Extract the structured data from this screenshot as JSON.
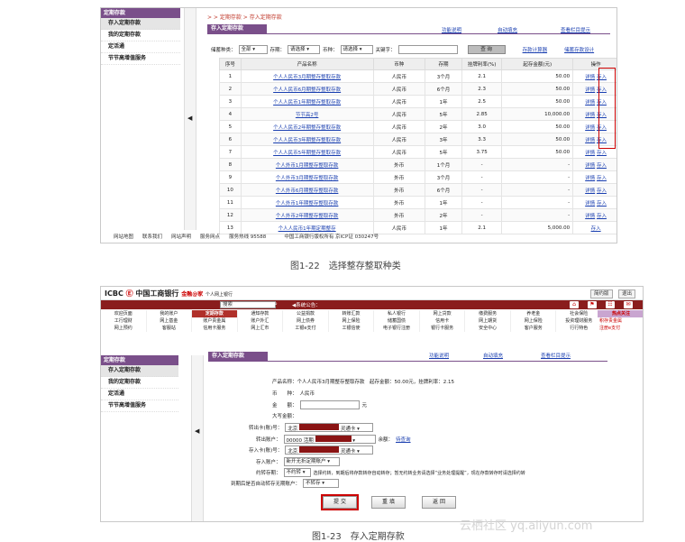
{
  "fig1": {
    "sidebar": {
      "header": "定期存款",
      "items": [
        "存入定期存款",
        "我的定期存款",
        "定活通",
        "节节高增值服务"
      ]
    },
    "breadcrumb": "> > 定期存款 > 存入定期存款",
    "panel_title": "存入定期存款",
    "top_links": [
      "功能说明",
      "自动填充",
      "查看栏目提示"
    ],
    "filters": {
      "store_type_label": "储蓄种类：",
      "store_type_value": "全部",
      "term_label": "存期：",
      "term_value": "请选择",
      "currency_label": "币种：",
      "currency_value": "请选择",
      "keyword_label": "关键字：",
      "query_button": "查 询",
      "calc_link": "存款计算器",
      "design_link": "储蓄存款设计"
    },
    "table": {
      "headers": [
        "序号",
        "产品名称",
        "币种",
        "存期",
        "挂牌利率(%)",
        "起存金额(元)",
        "操作"
      ],
      "rows": [
        {
          "no": "1",
          "name": "个人人民币3月期整存整取存款",
          "cur": "人民币",
          "term": "3个月",
          "rate": "2.1",
          "min": "50.00",
          "detail": "详情",
          "action": "存入"
        },
        {
          "no": "2",
          "name": "个人人民币6月期整存整取存款",
          "cur": "人民币",
          "term": "6个月",
          "rate": "2.3",
          "min": "50.00",
          "detail": "详情",
          "action": "存入"
        },
        {
          "no": "3",
          "name": "个人人民币1年期整存整取存款",
          "cur": "人民币",
          "term": "1年",
          "rate": "2.5",
          "min": "50.00",
          "detail": "详情",
          "action": "存入"
        },
        {
          "no": "4",
          "name": "节节高2号",
          "cur": "人民币",
          "term": "5年",
          "rate": "2.85",
          "min": "10,000.00",
          "detail": "详情",
          "action": "存入"
        },
        {
          "no": "5",
          "name": "个人人民币2年期整存整取存款",
          "cur": "人民币",
          "term": "2年",
          "rate": "3.0",
          "min": "50.00",
          "detail": "详情",
          "action": "存入"
        },
        {
          "no": "6",
          "name": "个人人民币3年期整存整取存款",
          "cur": "人民币",
          "term": "3年",
          "rate": "3.3",
          "min": "50.00",
          "detail": "详情",
          "action": "存入"
        },
        {
          "no": "7",
          "name": "个人人民币5年期整存整取存款",
          "cur": "人民币",
          "term": "5年",
          "rate": "3.75",
          "min": "50.00",
          "detail": "详情",
          "action": "存入"
        },
        {
          "no": "8",
          "name": "个人外币1月期整存整取存款",
          "cur": "外币",
          "term": "1个月",
          "rate": "-",
          "min": "-",
          "detail": "详情",
          "action": "存入"
        },
        {
          "no": "9",
          "name": "个人外币3月期整存整取存款",
          "cur": "外币",
          "term": "3个月",
          "rate": "-",
          "min": "-",
          "detail": "详情",
          "action": "存入"
        },
        {
          "no": "10",
          "name": "个人外币6月期整存整取存款",
          "cur": "外币",
          "term": "6个月",
          "rate": "-",
          "min": "-",
          "detail": "详情",
          "action": "存入"
        },
        {
          "no": "11",
          "name": "个人外币1年期整存整取存款",
          "cur": "外币",
          "term": "1年",
          "rate": "-",
          "min": "-",
          "detail": "详情",
          "action": "存入"
        },
        {
          "no": "12",
          "name": "个人外币2年期整存整取存款",
          "cur": "外币",
          "term": "2年",
          "rate": "-",
          "min": "-",
          "detail": "详情",
          "action": "存入"
        },
        {
          "no": "13",
          "name": "个人人民币1年期定期整存",
          "cur": "人民币",
          "term": "1年",
          "rate": "2.1",
          "min": "5,000.00",
          "detail": "",
          "action": "存入"
        }
      ]
    },
    "footer": [
      "网站地图",
      "联系我们",
      "网站声明",
      "服务网点",
      "服务热线 95588",
      "中国工商银行版权所有 京ICP证 030247号"
    ],
    "caption": "图1-22　选择整存整取种类"
  },
  "fig2": {
    "logo_brand": "ICBC",
    "logo_name": "中国工商银行",
    "logo_sub": "金融@家",
    "logo_sub2": "个人网上银行",
    "top_buttons": [
      "简约版",
      "退出"
    ],
    "search_value": "搜索",
    "announce": "◀系统公告：",
    "nav_rows": [
      [
        "欢迎页面",
        "我的账户",
        "定期存款",
        "通知存款",
        "公益捐款",
        "转账汇款",
        "私人银行",
        "网上贷款",
        "缴费服务",
        "养老金",
        "社会保险"
      ],
      [
        "工行理财",
        "网上基金",
        "账户贵金属",
        "账户外汇",
        "网上债券",
        "网上保险",
        "储蓄国债",
        "信用卡",
        "网上期货",
        "网上保险",
        "投资理财服务"
      ],
      [
        "网上预约",
        "客服站",
        "信用卡服务",
        "网上汇市",
        "工银e支付",
        "工银信使",
        "电子银行注册",
        "银行卡服务",
        "安全中心",
        "客户服务",
        "行行特色"
      ]
    ],
    "active_nav": "定期存款",
    "hot": {
      "title": "热点关注",
      "items": [
        "积存贵金属",
        "注册e支付"
      ]
    },
    "sidebar": {
      "header": "定期存款",
      "items": [
        "存入定期存款",
        "我的定期存款",
        "定活通",
        "节节高增值服务"
      ]
    },
    "panel_title": "存入定期存款",
    "top_links": [
      "功能说明",
      "自动填充",
      "查看栏目提示"
    ],
    "form": {
      "product_line": "产品名称：个人人民币3月期整存整取存款　起存金额：50.00元，挂牌利率：2.15",
      "currency_label": "币　　种：",
      "currency_value": "人民币",
      "amount_label": "金　　额：",
      "amount_unit": "元",
      "uppercase_label": "大写金额：",
      "out_card_label": "转出卡(账)号：",
      "out_card_prefix": "北京",
      "out_card_suffix": "灵通卡",
      "out_account_label": "转出账户：",
      "out_account_value": "00000 活期",
      "balance_label": "余额：",
      "balance_link": "待查询",
      "in_card_label": "存入卡(账)号：",
      "in_card_prefix": "北京",
      "in_card_suffix": "灵通卡",
      "in_account_label": "存入账户：",
      "in_account_value": "新开无折定期账户",
      "renew_label": "约转存期：",
      "renew_value": "不约转",
      "renew_note": "选择约转，到期后将存款转存自动转存；暂无约转业务请选择“业务处理提醒”，现在存款转存时请选择约转",
      "renew_on_expiry_label": "到期后是否自动转存无期账户：",
      "renew_on_expiry_value": "不转存"
    },
    "buttons": {
      "submit": "提 交",
      "reset": "重 填",
      "back": "返 回"
    },
    "caption": "图1-23　存入定期存款",
    "watermark": "云栖社区 yq.aliyun.com"
  }
}
